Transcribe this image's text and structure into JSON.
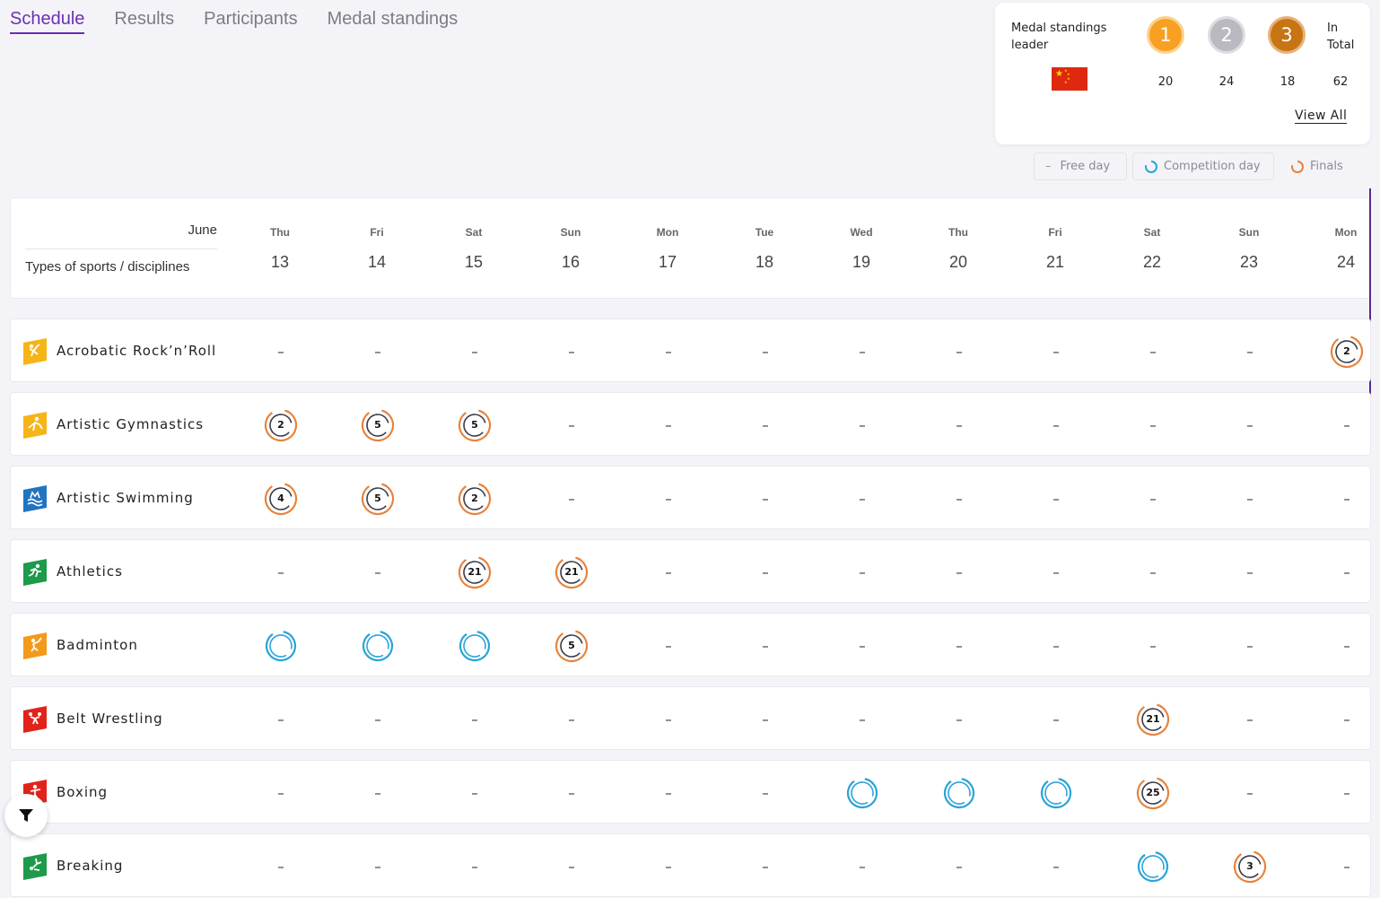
{
  "tabs": [
    "Schedule",
    "Results",
    "Participants",
    "Medal standings"
  ],
  "medal_card": {
    "title": "Medal standings leader",
    "flag_icon": "china-flag",
    "gold_label": "1",
    "silver_label": "2",
    "bronze_label": "3",
    "total_label": "In Total",
    "gold": "20",
    "silver": "24",
    "bronze": "18",
    "total": "62",
    "view_all": "View All",
    "colors": {
      "gold": "#f7a024",
      "silver": "#b9b9bf",
      "bronze": "#c77413"
    }
  },
  "legend": {
    "free_day": "Free day",
    "competition_day": "Competition day",
    "finals": "Finals"
  },
  "header": {
    "month": "June",
    "types_label": "Types of sports / disciplines",
    "days": [
      {
        "dow": "Thu",
        "num": "13"
      },
      {
        "dow": "Fri",
        "num": "14"
      },
      {
        "dow": "Sat",
        "num": "15"
      },
      {
        "dow": "Sun",
        "num": "16"
      },
      {
        "dow": "Mon",
        "num": "17"
      },
      {
        "dow": "Tue",
        "num": "18"
      },
      {
        "dow": "Wed",
        "num": "19"
      },
      {
        "dow": "Thu",
        "num": "20"
      },
      {
        "dow": "Fri",
        "num": "21"
      },
      {
        "dow": "Sat",
        "num": "22"
      },
      {
        "dow": "Sun",
        "num": "23"
      },
      {
        "dow": "Mon",
        "num": "24"
      }
    ]
  },
  "colors": {
    "accent": "#6a2fb4",
    "competition": "#29a4d6",
    "finals_orange": "#e8823a",
    "finals_dark": "#3a3a48"
  },
  "sports": [
    {
      "name": "Acrobatic Rock’n’Roll",
      "icon": "acrobatic-rock-n-roll-icon",
      "icon_color": "#f6b418",
      "cells": [
        "-",
        "-",
        "-",
        "-",
        "-",
        "-",
        "-",
        "-",
        "-",
        "-",
        "-",
        "F2"
      ]
    },
    {
      "name": "Artistic Gymnastics",
      "icon": "artistic-gymnastics-icon",
      "icon_color": "#f6b418",
      "cells": [
        "F2",
        "F5",
        "F5",
        "-",
        "-",
        "-",
        "-",
        "-",
        "-",
        "-",
        "-",
        "-"
      ]
    },
    {
      "name": "Artistic Swimming",
      "icon": "artistic-swimming-icon",
      "icon_color": "#2174c0",
      "cells": [
        "F4",
        "F5",
        "F2",
        "-",
        "-",
        "-",
        "-",
        "-",
        "-",
        "-",
        "-",
        "-"
      ]
    },
    {
      "name": "Athletics",
      "icon": "athletics-icon",
      "icon_color": "#1d9a4a",
      "cells": [
        "-",
        "-",
        "F21",
        "F21",
        "-",
        "-",
        "-",
        "-",
        "-",
        "-",
        "-",
        "-"
      ]
    },
    {
      "name": "Badminton",
      "icon": "badminton-icon",
      "icon_color": "#f39a1b",
      "cells": [
        "C",
        "C",
        "C",
        "F5",
        "-",
        "-",
        "-",
        "-",
        "-",
        "-",
        "-",
        "-"
      ]
    },
    {
      "name": "Belt Wrestling",
      "icon": "belt-wrestling-icon",
      "icon_color": "#e2231a",
      "cells": [
        "-",
        "-",
        "-",
        "-",
        "-",
        "-",
        "-",
        "-",
        "-",
        "F21",
        "-",
        "-"
      ]
    },
    {
      "name": "Boxing",
      "icon": "boxing-icon",
      "icon_color": "#e2231a",
      "cells": [
        "-",
        "-",
        "-",
        "-",
        "-",
        "-",
        "C",
        "C",
        "C",
        "F25",
        "-",
        "-"
      ]
    },
    {
      "name": "Breaking",
      "icon": "breaking-icon",
      "icon_color": "#1d9a4a",
      "cells": [
        "-",
        "-",
        "-",
        "-",
        "-",
        "-",
        "-",
        "-",
        "-",
        "C",
        "F3",
        "-"
      ]
    }
  ]
}
